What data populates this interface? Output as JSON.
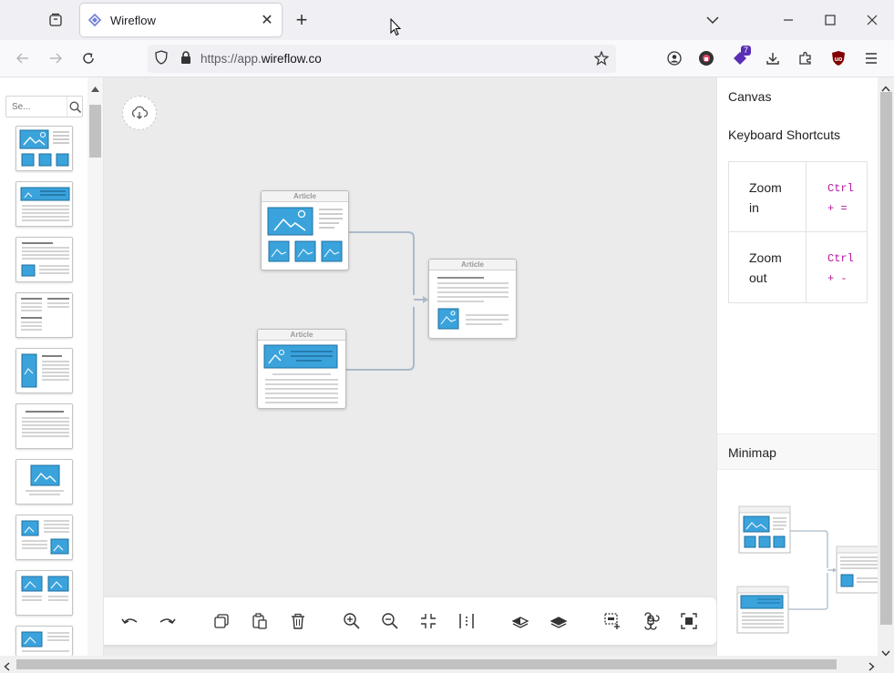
{
  "browser": {
    "tab_title": "Wireflow",
    "url_prefix": "https://app.",
    "url_host": "wireflow.co",
    "extension_badge": "7"
  },
  "left_panel": {
    "search_placeholder": "Se..."
  },
  "canvas": {
    "nodes": [
      {
        "id": "article-1",
        "label": "Article"
      },
      {
        "id": "article-2",
        "label": "Article"
      },
      {
        "id": "article-3",
        "label": "Article"
      }
    ]
  },
  "right_panel": {
    "canvas_title": "Canvas",
    "shortcuts_title": "Keyboard Shortcuts",
    "shortcuts": [
      {
        "label_line1": "Zoom",
        "label_line2": "in",
        "keys_line1": "Ctrl",
        "keys_line2": "+ ="
      },
      {
        "label_line1": "Zoom",
        "label_line2": "out",
        "keys_line1": "Ctrl",
        "keys_line2": "+ -"
      }
    ],
    "minimap_title": "Minimap"
  },
  "colors": {
    "accent_blue": "#3ba3dc",
    "line_blue": "#1f6f9f",
    "connector": "#a9bac9"
  }
}
